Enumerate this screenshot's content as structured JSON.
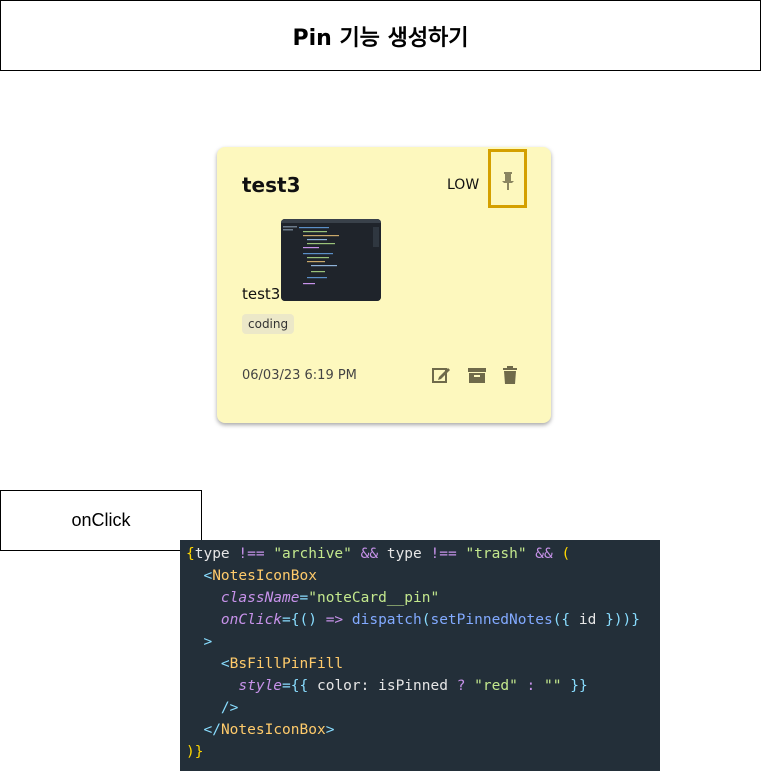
{
  "header": {
    "title": "Pin 기능 생성하기"
  },
  "note_card": {
    "title": "test3",
    "priority": "LOW",
    "body": "test3",
    "tag": "coding",
    "date": "06/03/23 6:19 PM",
    "pin_icon": "pin-icon",
    "action_icons": [
      "edit-icon",
      "archive-icon",
      "trash-icon"
    ],
    "background_color": "#fdf8be",
    "highlight_color": "#d4a000"
  },
  "onclick_label": "onClick",
  "code": {
    "lines": [
      "{type !== \"archive\" && type !== \"trash\" && (",
      "  <NotesIconBox",
      "    className=\"noteCard__pin\"",
      "    onClick={() => dispatch(setPinnedNotes({ id }))}",
      "  >",
      "    <BsFillPinFill",
      "      style={{ color: isPinned ? \"red\" : \"\" }}",
      "    />",
      "  </NotesIconBox>",
      ")}"
    ],
    "background_color": "#232f39"
  }
}
